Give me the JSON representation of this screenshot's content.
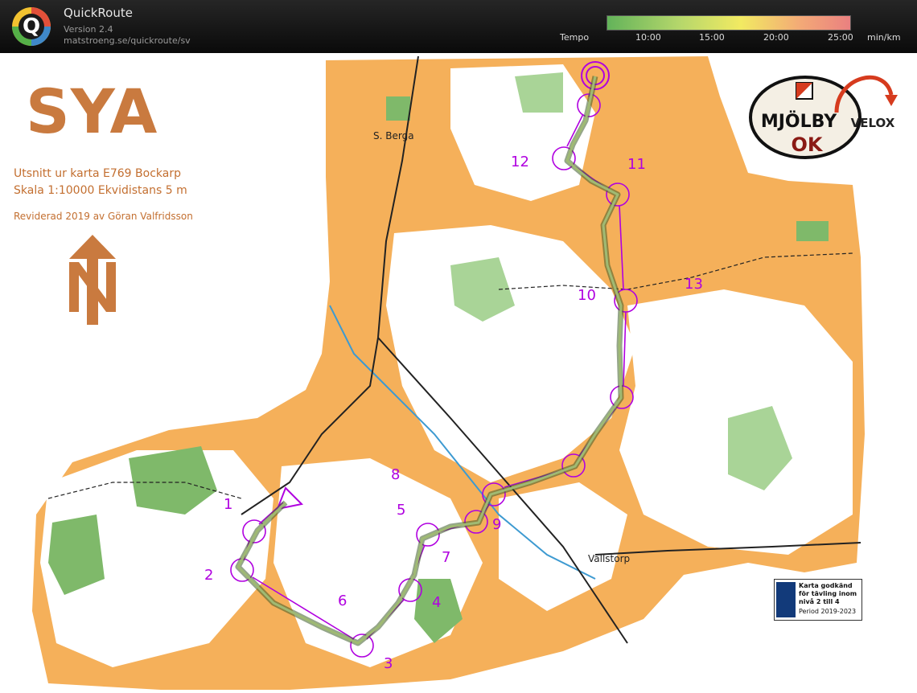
{
  "header": {
    "app_name": "QuickRoute",
    "version": "Version 2.4",
    "url": "matstroeng.se/quickroute/sv",
    "pace_legend": {
      "label": "Tempo",
      "ticks": [
        "10:00",
        "15:00",
        "20:00",
        "25:00"
      ],
      "unit": "min/km",
      "gradient_colors": [
        "#63b35a",
        "#b6d76b",
        "#f2ea62",
        "#f3a877",
        "#ea8080"
      ]
    }
  },
  "map": {
    "title": "SYA",
    "subtitle_line1": "Utsnitt ur karta E769 Bockarp",
    "subtitle_line2": "Skala 1:10000  Ekvidistans 5 m",
    "revision": "Reviderad 2019 av Göran Valfridsson",
    "place_names": [
      "S. Berga",
      "Vallstorp"
    ],
    "club_logo_text": [
      "MJÖLBY",
      "OK",
      "VELOX"
    ],
    "control_labels": [
      "1",
      "2",
      "3",
      "4",
      "5",
      "6",
      "7",
      "8",
      "9",
      "10",
      "11",
      "12",
      "13"
    ],
    "approval_badge": {
      "line1": "Karta godkänd",
      "line2": "för tävling inom",
      "line3": "nivå 2 till 4",
      "line4": "Period 2019-2023"
    },
    "colors": {
      "open_land": "#f5b05a",
      "forest": "#ffffff",
      "green": "#7fb96a",
      "course": "#b000e0",
      "route": "#6f8c4d",
      "title_brown": "#c97a3f"
    }
  }
}
